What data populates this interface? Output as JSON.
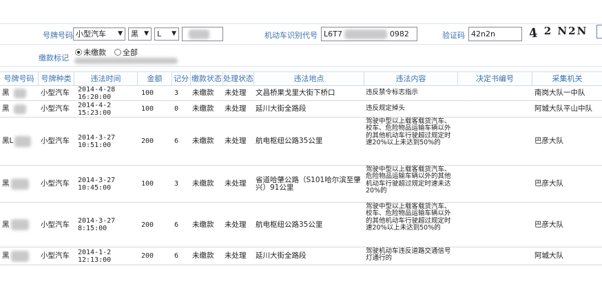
{
  "form": {
    "plate_label": "号牌号码",
    "vehicle_type_value": "小型汽车",
    "province_value": "黑",
    "letter_value": "L",
    "vin_label": "机动车识别代号",
    "vin_prefix": "L6T7",
    "vin_suffix": "0982",
    "captcha_label": "验证码",
    "captcha_input_value": "42n2n",
    "captcha_image_text_1": "4",
    "captcha_image_text_2": "2 N2N",
    "payment_flag_label": "缴款标记",
    "radio_unpaid": "未缴款",
    "radio_all": "全部",
    "selected_radio": "未缴款"
  },
  "table": {
    "headers": [
      "号牌号码",
      "号牌种类",
      "违法时间",
      "金额",
      "记分",
      "缴款状态",
      "处理状态",
      "违法地点",
      "违法内容",
      "决定书编号",
      "采集机关"
    ],
    "rows": [
      {
        "plate": "黑",
        "plate_type": "小型汽车",
        "date": "2014-4-28",
        "time": "16:20:00",
        "amount": "100",
        "points": "3",
        "pay_status": "未缴款",
        "proc_status": "未处理",
        "location": "文昌桥果戈里大街下桥口",
        "content": "违反禁令标志指示",
        "decision_no": "",
        "agency": "南岗大队一中队"
      },
      {
        "plate": "黑",
        "plate_type": "小型汽车",
        "date": "2014-4-2",
        "time": "15:23:00",
        "amount": "100",
        "points": "0",
        "pay_status": "未缴款",
        "proc_status": "未处理",
        "location": "延川大街全路段",
        "content": "违反规定掉头",
        "decision_no": "",
        "agency": "阿城大队平山中队"
      },
      {
        "plate": "黑L",
        "plate_type": "小型汽车",
        "date": "2014-3-27",
        "time": "10:51:00",
        "amount": "200",
        "points": "6",
        "pay_status": "未缴款",
        "proc_status": "未处理",
        "location": "航电枢纽公路35公里",
        "content": "驾驶中型以上载客载货汽车、校车、危险物品运输车辆以外的其他机动车行驶超过规定时速20%以上未达到50%的",
        "decision_no": "",
        "agency": "巴彦大队"
      },
      {
        "plate": "黑",
        "plate_type": "小型汽车",
        "date": "2014-3-27",
        "time": "10:45:00",
        "amount": "100",
        "points": "3",
        "pay_status": "未缴款",
        "proc_status": "未处理",
        "location": "省道哈肇公路（S101哈尔滨至肇兴）91公里",
        "content": "驾驶中型以上载客载货汽车、危险物品运输车辆以外的其他机动车行驶超过规定时速未达20%的",
        "decision_no": "",
        "agency": "巴彦大队"
      },
      {
        "plate": "黑",
        "plate_type": "小型汽车",
        "date": "2014-3-27",
        "time": "8:15:00",
        "amount": "200",
        "points": "6",
        "pay_status": "未缴款",
        "proc_status": "未处理",
        "location": "航电枢纽公路35公里",
        "content": "驾驶中型以上载客载货汽车、校车、危险物品运输车辆以外的其他机动车行驶超过规定时速20%以上未达到50%的",
        "decision_no": "",
        "agency": "巴彦大队"
      },
      {
        "plate": "黑",
        "plate_type": "小型汽车",
        "date": "2014-1-2",
        "time": "12:13:00",
        "amount": "200",
        "points": "6",
        "pay_status": "未缴款",
        "proc_status": "未处理",
        "location": "延川大街全路段",
        "content": "驾驶机动车违反道路交通信号灯通行的",
        "decision_no": "",
        "agency": "阿城大队"
      }
    ]
  }
}
